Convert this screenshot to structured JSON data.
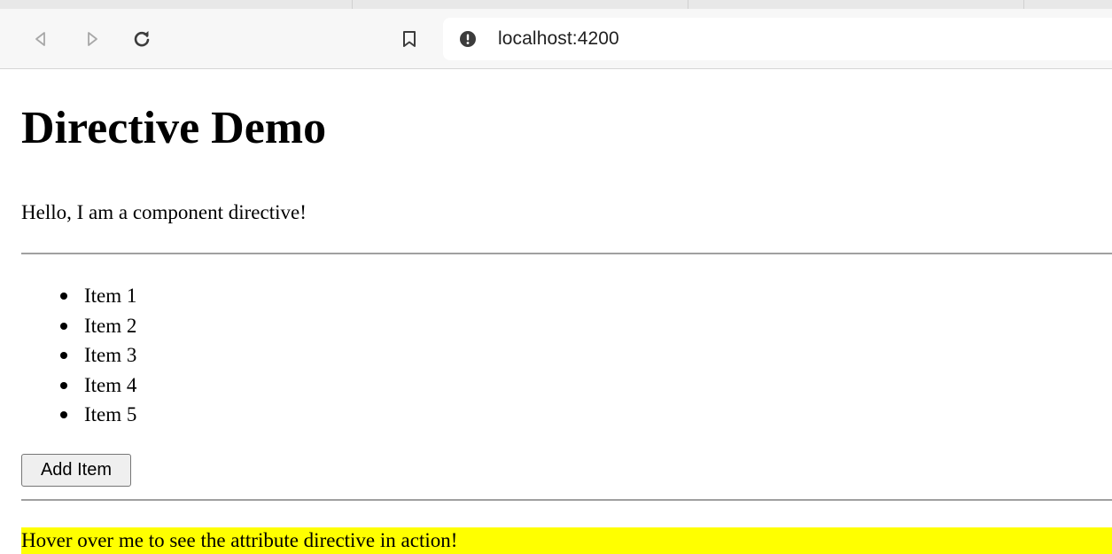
{
  "browser": {
    "url": "localhost:4200",
    "icons": {
      "back": "back-arrow-icon",
      "forward": "forward-arrow-icon",
      "reload": "reload-icon",
      "bookmark": "bookmark-icon",
      "site_info": "info-icon"
    }
  },
  "page": {
    "title": "Directive Demo",
    "intro": "Hello, I am a component directive!",
    "items": [
      "Item 1",
      "Item 2",
      "Item 3",
      "Item 4",
      "Item 5"
    ],
    "add_button_label": "Add Item",
    "hover_text": "Hover over me to see the attribute directive in action!",
    "hover_highlight_color": "#ffff00"
  }
}
